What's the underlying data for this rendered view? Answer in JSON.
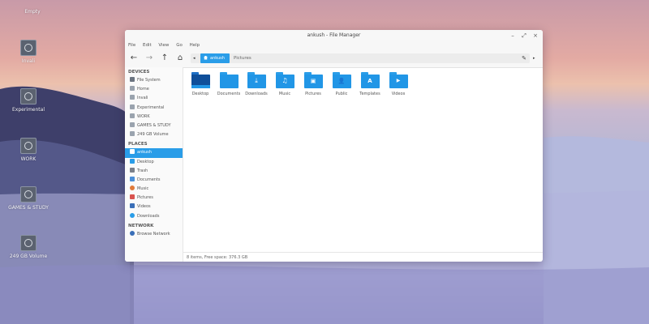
{
  "desktop": {
    "icons": [
      {
        "label": "Empty",
        "icon": "drive-icon"
      },
      {
        "label": "Invali",
        "icon": "drive-icon"
      },
      {
        "label": "Experimental",
        "icon": "drive-icon"
      },
      {
        "label": "WORK",
        "icon": "drive-icon"
      },
      {
        "label": "GAMES & STUDY",
        "icon": "drive-icon"
      },
      {
        "label": "249 GB Volume",
        "icon": "drive-icon"
      }
    ]
  },
  "window": {
    "title": "ankush - File Manager",
    "controls": {
      "minimize": "–",
      "maximize": "⤢",
      "close": "×"
    }
  },
  "menu": [
    "File",
    "Edit",
    "View",
    "Go",
    "Help"
  ],
  "toolbar": {
    "back": "←",
    "forward": "→",
    "up": "↑",
    "home": "⌂",
    "path_left": "◂",
    "crumb_active": "ankush",
    "crumb_next": "Pictures",
    "edit": "✎",
    "path_right": "▸"
  },
  "sidebar": {
    "devices_header": "DEVICES",
    "devices": [
      "File System",
      "Home",
      "Invali",
      "Experimental",
      "WORK",
      "GAMES & STUDY",
      "249 GB Volume"
    ],
    "places_header": "PLACES",
    "places": [
      "ankush",
      "Desktop",
      "Trash",
      "Documents",
      "Music",
      "Pictures",
      "Videos",
      "Downloads"
    ],
    "places_active": "ankush",
    "network_header": "NETWORK",
    "network": [
      "Browse Network"
    ]
  },
  "files": [
    {
      "name": "Desktop",
      "glyph": ""
    },
    {
      "name": "Documents",
      "glyph": ""
    },
    {
      "name": "Downloads",
      "glyph": "⤓"
    },
    {
      "name": "Music",
      "glyph": "♫"
    },
    {
      "name": "Pictures",
      "glyph": "▣"
    },
    {
      "name": "Public",
      "glyph": "👤"
    },
    {
      "name": "Templates",
      "glyph": "A"
    },
    {
      "name": "Videos",
      "glyph": "▶"
    }
  ],
  "status": "8 items, Free space: 376.3 GB",
  "colors": {
    "accent": "#2a9de8",
    "folder": "#2196e6"
  }
}
